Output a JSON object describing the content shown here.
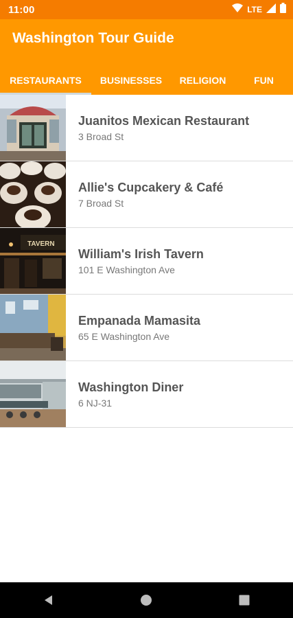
{
  "status": {
    "time": "11:00",
    "network": "LTE"
  },
  "app": {
    "title": "Washington Tour Guide"
  },
  "tabs": [
    {
      "label": "RESTAURANTS",
      "selected": true
    },
    {
      "label": "BUSINESSES",
      "selected": false
    },
    {
      "label": "RELIGION",
      "selected": false
    },
    {
      "label": "FUN",
      "selected": false
    }
  ],
  "places": [
    {
      "name": "Juanitos Mexican Restaurant",
      "address": "3 Broad St"
    },
    {
      "name": "Allie's Cupcakery & Café",
      "address": "7 Broad St"
    },
    {
      "name": "William's Irish Tavern",
      "address": "101 E Washington Ave"
    },
    {
      "name": "Empanada Mamasita",
      "address": "65 E Washington Ave"
    },
    {
      "name": "Washington Diner",
      "address": "6 NJ-31"
    }
  ],
  "colors": {
    "status_bar": "#f57c00",
    "app_bar": "#ff9800"
  },
  "icons": {
    "wifi": "wifi-icon",
    "signal": "signal-icon",
    "battery": "battery-icon",
    "back": "back-icon",
    "home": "home-icon",
    "recents": "recents-icon"
  }
}
